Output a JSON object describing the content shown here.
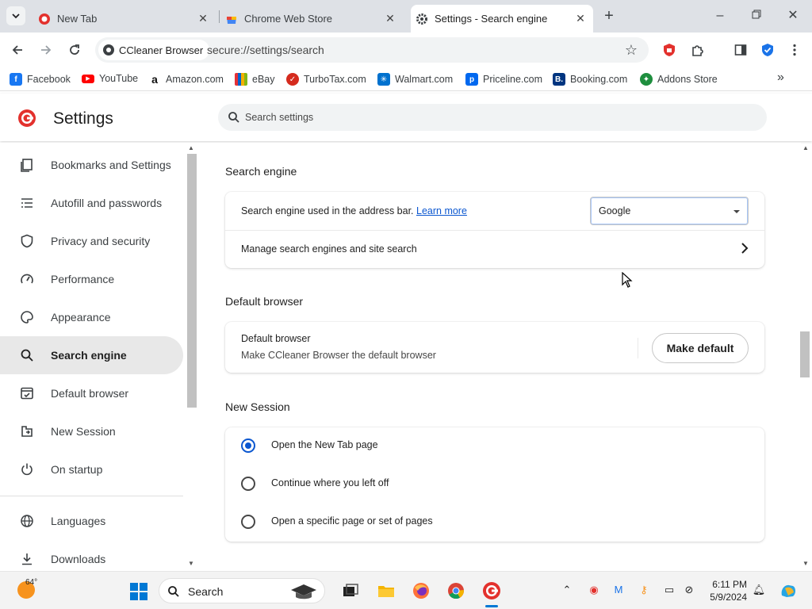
{
  "tabs": [
    {
      "title": "New Tab"
    },
    {
      "title": "Chrome Web Store"
    },
    {
      "title": "Settings - Search engine",
      "active": true
    }
  ],
  "toolbar": {
    "site_chip": "CCleaner Browser",
    "url": "secure://settings/search"
  },
  "bookmarks": [
    {
      "label": "Facebook",
      "icon": "facebook-icon",
      "color": "#1877f2"
    },
    {
      "label": "YouTube",
      "icon": "youtube-icon",
      "color": "#ff0000"
    },
    {
      "label": "Amazon.com",
      "icon": "amazon-icon",
      "color": "#111111"
    },
    {
      "label": "eBay",
      "icon": "ebay-icon",
      "color": "#e53238"
    },
    {
      "label": "TurboTax.com",
      "icon": "turbotax-icon",
      "color": "#d52b1e"
    },
    {
      "label": "Walmart.com",
      "icon": "walmart-icon",
      "color": "#0071ce"
    },
    {
      "label": "Priceline.com",
      "icon": "priceline-icon",
      "color": "#0068ef"
    },
    {
      "label": "Booking.com",
      "icon": "booking-icon",
      "color": "#003580"
    },
    {
      "label": "Addons Store",
      "icon": "addons-store-icon",
      "color": "#1e8e3e"
    }
  ],
  "header": {
    "title": "Settings",
    "search_placeholder": "Search settings"
  },
  "sidebar": {
    "items": [
      {
        "label": "Bookmarks and Settings",
        "icon": "bookmarks-icon"
      },
      {
        "label": "Autofill and passwords",
        "icon": "autofill-icon"
      },
      {
        "label": "Privacy and security",
        "icon": "shield-icon"
      },
      {
        "label": "Performance",
        "icon": "speedometer-icon"
      },
      {
        "label": "Appearance",
        "icon": "palette-icon"
      },
      {
        "label": "Search engine",
        "icon": "search-icon",
        "active": true
      },
      {
        "label": "Default browser",
        "icon": "browser-icon"
      },
      {
        "label": "New Session",
        "icon": "new-session-icon"
      },
      {
        "label": "On startup",
        "icon": "power-icon"
      },
      {
        "label": "Languages",
        "icon": "globe-icon"
      },
      {
        "label": "Downloads",
        "icon": "download-icon"
      }
    ]
  },
  "main": {
    "search_engine": {
      "heading": "Search engine",
      "row1_label": "Search engine used in the address bar.",
      "learn_more": "Learn more",
      "selected_engine": "Google",
      "row2_label": "Manage search engines and site search"
    },
    "default_browser": {
      "heading": "Default browser",
      "title": "Default browser",
      "subtitle": "Make CCleaner Browser the default browser",
      "button": "Make default"
    },
    "new_session": {
      "heading": "New Session",
      "options": [
        {
          "label": "Open the New Tab page",
          "checked": true
        },
        {
          "label": "Continue where you left off",
          "checked": false
        },
        {
          "label": "Open a specific page or set of pages",
          "checked": false
        }
      ]
    }
  },
  "taskbar": {
    "temperature": "64°",
    "search_label": "Search",
    "time": "6:11 PM",
    "date": "5/9/2024"
  },
  "colors": {
    "accent": "#0b57d0",
    "active_nav_bg": "#e8e8e8",
    "brand_red": "#e3312d"
  }
}
